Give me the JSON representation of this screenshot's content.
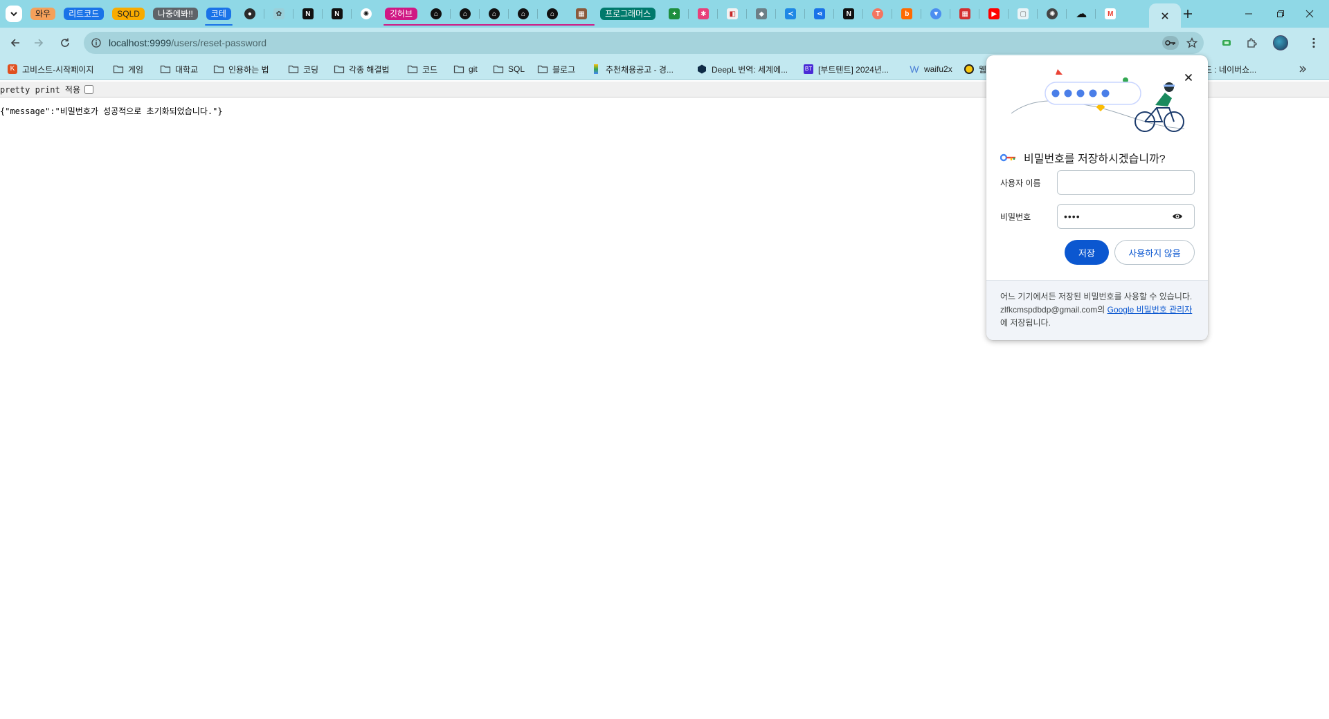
{
  "tab_groups": [
    {
      "label": "와우",
      "bg": "#f5a05a",
      "fg": "#1f1f1f"
    },
    {
      "label": "리트코드",
      "bg": "#1a73e8",
      "fg": "#ffffff"
    },
    {
      "label": "SQLD",
      "bg": "#f9ab00",
      "fg": "#1f1f1f"
    },
    {
      "label": "나중에봐!!",
      "bg": "#5f6368",
      "fg": "#ffffff"
    },
    {
      "label": "코테",
      "bg": "#1a73e8",
      "fg": "#ffffff"
    },
    {
      "label": "깃허브",
      "bg": "#d01884",
      "fg": "#ffffff"
    },
    {
      "label": "프로그래머스",
      "bg": "#00796b",
      "fg": "#ffffff"
    }
  ],
  "address_bar": {
    "host": "localhost:9999",
    "path": "/users/reset-password"
  },
  "bookmarks": [
    {
      "label": "고비스트-시작페이지",
      "icon": "site-icon"
    },
    {
      "label": "게임",
      "icon": "folder-icon"
    },
    {
      "label": "대학교",
      "icon": "folder-icon"
    },
    {
      "label": "인용하는 법",
      "icon": "folder-icon"
    },
    {
      "label": "코딩",
      "icon": "folder-icon"
    },
    {
      "label": "각종 해결법",
      "icon": "folder-icon"
    },
    {
      "label": "코드",
      "icon": "folder-icon"
    },
    {
      "label": "git",
      "icon": "folder-icon"
    },
    {
      "label": "SQL",
      "icon": "folder-icon"
    },
    {
      "label": "블로그",
      "icon": "folder-icon"
    },
    {
      "label": "추천채용공고 - 경...",
      "icon": "site-icon"
    },
    {
      "label": "DeepL 번역: 세계에...",
      "icon": "deepl-icon"
    },
    {
      "label": "[부트텐트] 2024년...",
      "icon": "site-icon"
    },
    {
      "label": "waifu2x",
      "icon": "w-icon"
    },
    {
      "label": "웹",
      "icon": "site-icon"
    },
    {
      "label": "드 : 네이버쇼...",
      "icon": "site-icon"
    }
  ],
  "page": {
    "pretty_print_label": "pretty print 적용",
    "json_text": "{\"message\":\"비밀번호가 성공적으로 초기화되었습니다.\"}"
  },
  "password_bubble": {
    "title": "비밀번호를 저장하시겠습니까?",
    "username_label": "사용자 이름",
    "username_value": "",
    "password_label": "비밀번호",
    "password_masked": "••••",
    "save_label": "저장",
    "never_label": "사용하지 않음",
    "footer_text_1": "어느 기기에서든 저장된 비밀번호를 사용할 수 있습니다. zlfkcmspdbdp@gmail.com의 ",
    "footer_link": "Google 비밀번호 관리자",
    "footer_text_2": "에 저장됩니다."
  },
  "colors": {
    "tabstrip": "#8fd8e6",
    "toolbar": "#c2e8f0",
    "primary_button": "#0b57d0"
  }
}
